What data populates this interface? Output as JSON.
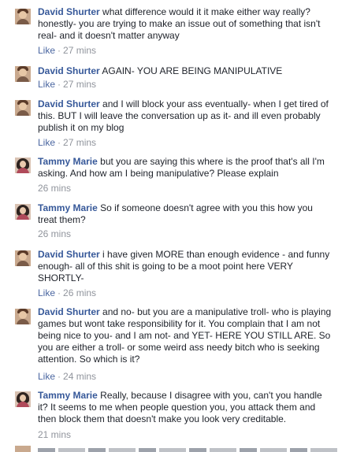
{
  "thread": {
    "comments": [
      {
        "author": "David Shurter",
        "text": "what difference would it it make either way really? honestly- you are trying to make an issue out of something that isn't real- and it doesn't matter anyway",
        "like_label": "Like",
        "separator": "·",
        "time": "27 mins"
      },
      {
        "author": "David Shurter",
        "text": "AGAIN- YOU ARE BEING MANIPULATIVE",
        "like_label": "Like",
        "separator": "·",
        "time": "27 mins"
      },
      {
        "author": "David Shurter",
        "text": "and I will block your ass eventually- when I get tired of this. BUT I will leave the conversation up as it- and ill even probably publish it on my blog",
        "like_label": "Like",
        "separator": "·",
        "time": "27 mins"
      },
      {
        "author": "Tammy Marie",
        "text": "but you are saying this where is the proof that's all I'm asking. And how am I being manipulative? Please explain",
        "time": "26 mins"
      },
      {
        "author": "Tammy Marie",
        "text": "So if someone doesn't agree with you this how you treat them?",
        "time": "26 mins"
      },
      {
        "author": "David Shurter",
        "text": "i have given MORE than enough evidence - and funny enough- all of this shit is going to be a moot point here VERY SHORTLY-",
        "like_label": "Like",
        "separator": "·",
        "time": "26 mins"
      },
      {
        "author": "David Shurter",
        "text": "and no- but you are a manipulative troll- who is playing games but wont take responsibility for it. You complain that I am not being nice to you- and I am not- and YET- HERE YOU STILL ARE. So you are either a troll- or some weird ass needy bitch who is seeking attention. So which is it?",
        "like_label": "Like",
        "separator": "·",
        "time": "24 mins"
      },
      {
        "author": "Tammy Marie",
        "text": "Really, because I disagree with you, can't you handle it? It seems to me when people question you, you attack them and then block them that doesn't make you look very creditable.",
        "time": "21 mins"
      }
    ]
  }
}
